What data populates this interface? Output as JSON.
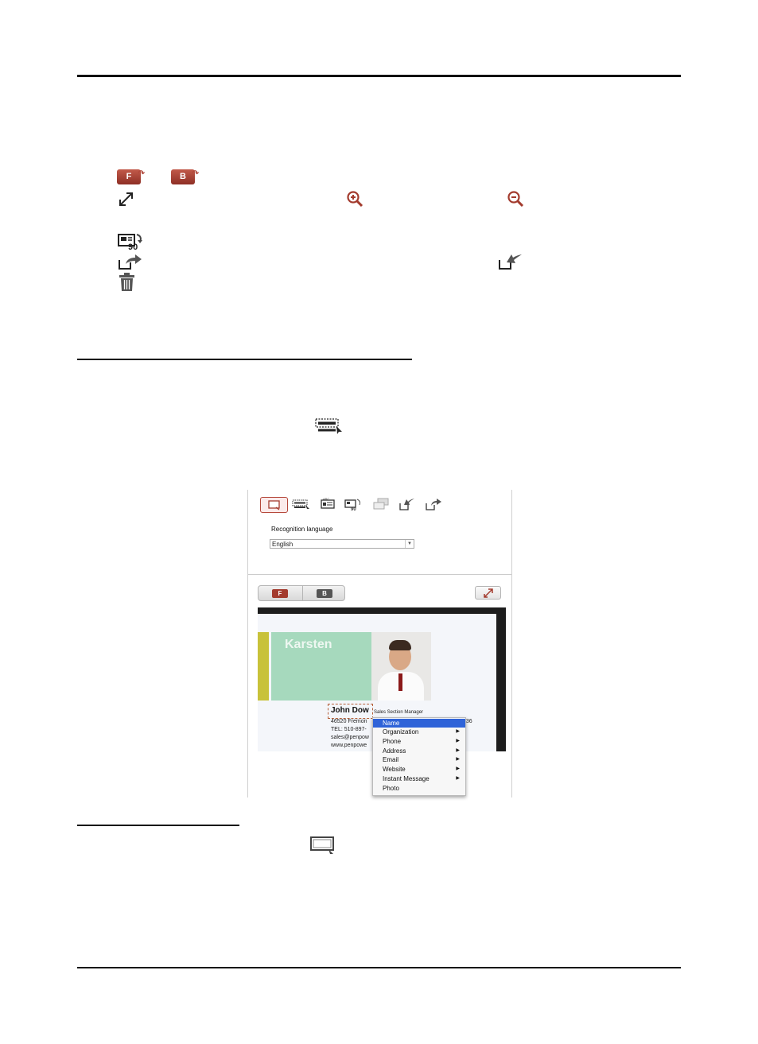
{
  "panel": {
    "recognition_language_label": "Recognition language",
    "language_value": "English",
    "front_label": "F",
    "back_label": "B"
  },
  "card": {
    "name_banner": "Karsten",
    "person_name": "John Dow",
    "job_title": "Sales Section Manager",
    "address_line": "46520 Fremon",
    "address_suffix": "536",
    "tel_line": "TEL: 510-897-",
    "email_line": "sales@penpow",
    "web_line": "www.penpowe"
  },
  "context_menu": {
    "items": [
      {
        "label": "Name",
        "submenu": false,
        "selected": true
      },
      {
        "label": "Organization",
        "submenu": true,
        "selected": false
      },
      {
        "label": "Phone",
        "submenu": true,
        "selected": false
      },
      {
        "label": "Address",
        "submenu": true,
        "selected": false
      },
      {
        "label": "Email",
        "submenu": true,
        "selected": false
      },
      {
        "label": "Website",
        "submenu": true,
        "selected": false
      },
      {
        "label": "Instant Message",
        "submenu": true,
        "selected": false
      },
      {
        "label": "Photo",
        "submenu": false,
        "selected": false
      }
    ]
  },
  "icons": {
    "front": "F",
    "back": "B",
    "rotate_90": "90"
  },
  "colors": {
    "accent_red": "#a33b2e",
    "menu_highlight": "#2f63d8",
    "card_green": "#9fd4b8",
    "card_yellow": "#c8c23a"
  }
}
